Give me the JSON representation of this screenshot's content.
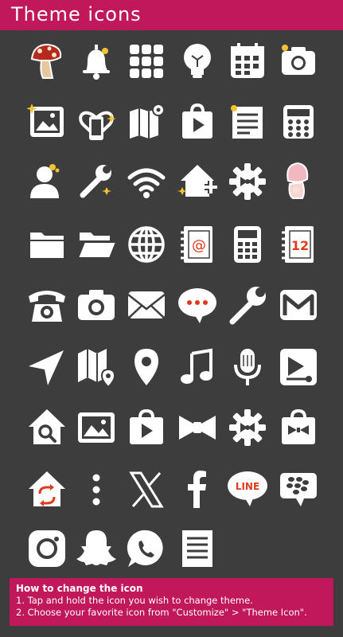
{
  "header": {
    "title": "Theme icons"
  },
  "footer": {
    "heading": "How to change the icon",
    "step1": "1. Tap and hold the icon you wish to change theme.",
    "step2": "2. Choose your favorite icon from \"Customize\" > \"Theme Icon\"."
  },
  "icons": [
    {
      "name": "mushroom-icon"
    },
    {
      "name": "bell-icon"
    },
    {
      "name": "app-grid-icon"
    },
    {
      "name": "lightbulb-icon"
    },
    {
      "name": "calendar-icon"
    },
    {
      "name": "camera-icon"
    },
    {
      "name": "gallery-icon"
    },
    {
      "name": "phone-heart-icon"
    },
    {
      "name": "map-icon"
    },
    {
      "name": "play-store-icon"
    },
    {
      "name": "notes-icon"
    },
    {
      "name": "calculator-icon"
    },
    {
      "name": "contacts-icon"
    },
    {
      "name": "wrench-settings-icon"
    },
    {
      "name": "wifi-icon"
    },
    {
      "name": "home-add-icon"
    },
    {
      "name": "gear-icon"
    },
    {
      "name": "pink-mushroom-icon"
    },
    {
      "name": "folder-icon"
    },
    {
      "name": "folder-open-icon"
    },
    {
      "name": "globe-icon"
    },
    {
      "name": "address-book-icon"
    },
    {
      "name": "calculator-small-icon"
    },
    {
      "name": "calendar-12-icon"
    },
    {
      "name": "telephone-icon"
    },
    {
      "name": "camera-2-icon"
    },
    {
      "name": "mail-icon"
    },
    {
      "name": "message-icon"
    },
    {
      "name": "wrench-icon"
    },
    {
      "name": "gmail-icon"
    },
    {
      "name": "navigation-icon"
    },
    {
      "name": "maps-pin-icon"
    },
    {
      "name": "location-pin-icon"
    },
    {
      "name": "music-note-icon"
    },
    {
      "name": "microphone-icon"
    },
    {
      "name": "video-player-icon"
    },
    {
      "name": "home-search-icon"
    },
    {
      "name": "image-icon"
    },
    {
      "name": "store-play-icon"
    },
    {
      "name": "bow-icon"
    },
    {
      "name": "gear-2-icon"
    },
    {
      "name": "store-bow-icon"
    },
    {
      "name": "home-sync-icon"
    },
    {
      "name": "more-dots-icon"
    },
    {
      "name": "x-logo-icon"
    },
    {
      "name": "facebook-icon"
    },
    {
      "name": "line-icon",
      "text": "LINE"
    },
    {
      "name": "blackberry-icon"
    },
    {
      "name": "instagram-icon"
    },
    {
      "name": "snapchat-icon"
    },
    {
      "name": "whatsapp-icon"
    },
    {
      "name": "document-icon"
    }
  ],
  "colors": {
    "header": "#c0185a",
    "background": "#3d3d3d",
    "icon": "#ffffff",
    "accent": "#e03a1e"
  }
}
